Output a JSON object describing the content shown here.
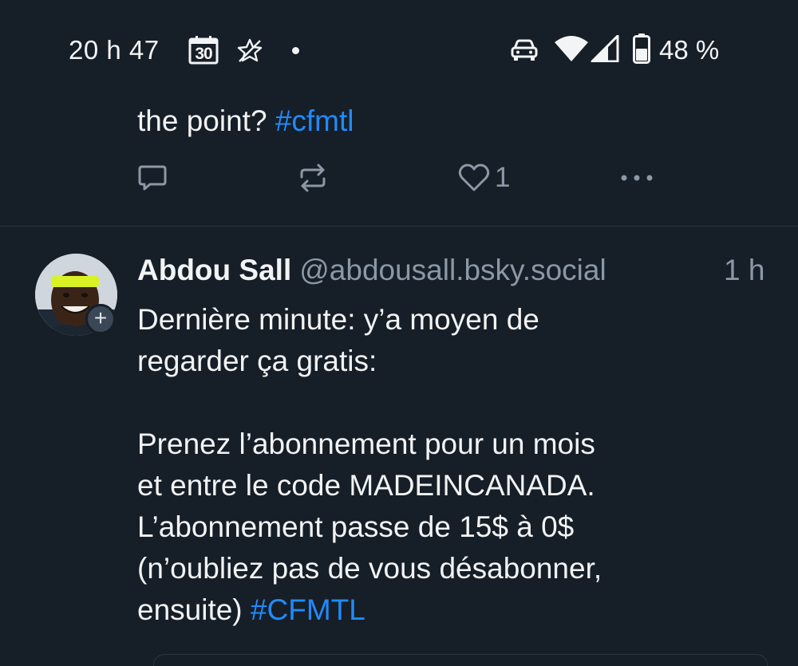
{
  "status_bar": {
    "time": "20 h 47",
    "calendar_day": "30",
    "battery_pct": "48 %",
    "icons": [
      "calendar-icon",
      "star-icon",
      "notification-dot-icon",
      "car-icon",
      "wifi-icon",
      "signal-icon",
      "battery-icon"
    ]
  },
  "previous_post": {
    "text_fragment": "the point? ",
    "hashtag": "#cfmtl",
    "like_count": "1"
  },
  "post": {
    "author_name": "Abdou Sall",
    "author_handle": "@abdousall.bsky.social",
    "time": "1 h",
    "follow_badge": "+",
    "lines": [
      "Dernière minute: y’a moyen de",
      "regarder ça gratis:",
      "",
      "Prenez l’abonnement pour un mois",
      "et entre le code MADEINCANADA.",
      "L’abonnement passe de 15$ à 0$",
      "(n’oubliez pas de vous désabonner,",
      "ensuite) "
    ],
    "hashtag": "#CFMTL"
  },
  "colors": {
    "background": "#161e27",
    "text": "#f1f3f5",
    "muted": "#8b98a5",
    "link": "#208bfe",
    "divider": "#2c3641"
  }
}
